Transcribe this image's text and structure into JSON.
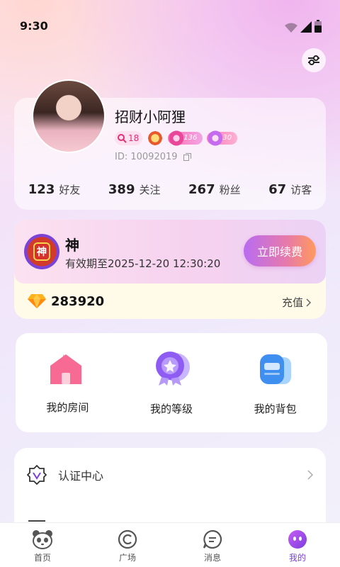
{
  "status_bar": {
    "time": "9:30"
  },
  "profile": {
    "username": "招财小阿狸",
    "search_badge": "18",
    "badge_level_1": "136",
    "badge_level_2": "30",
    "user_id": "ID: 10092019",
    "stats": [
      {
        "value": "123",
        "label": "好友"
      },
      {
        "value": "389",
        "label": "关注"
      },
      {
        "value": "267",
        "label": "粉丝"
      },
      {
        "value": "67",
        "label": "访客"
      }
    ]
  },
  "vip": {
    "emblem_text": "神",
    "level": "神",
    "expiry": "有效期至2025-12-20 12:30:20",
    "renew_label": "立即续费",
    "balance": "283920",
    "recharge_label": "充值"
  },
  "features": [
    {
      "label": "我的房间",
      "icon": "house-icon"
    },
    {
      "label": "我的等级",
      "icon": "level-medal-icon"
    },
    {
      "label": "我的背包",
      "icon": "backpack-icon"
    }
  ],
  "menu": {
    "verification_label": "认证中心"
  },
  "tabbar": [
    {
      "label": "首页",
      "icon": "panda-icon"
    },
    {
      "label": "广场",
      "icon": "square-icon"
    },
    {
      "label": "消息",
      "icon": "message-icon"
    },
    {
      "label": "我的",
      "icon": "profile-icon",
      "active": true
    }
  ],
  "colors": {
    "accent": "#7b3fe0",
    "renew_start": "#b86cf2",
    "renew_end": "#ff9a5c",
    "background": "#f4e2f8"
  }
}
